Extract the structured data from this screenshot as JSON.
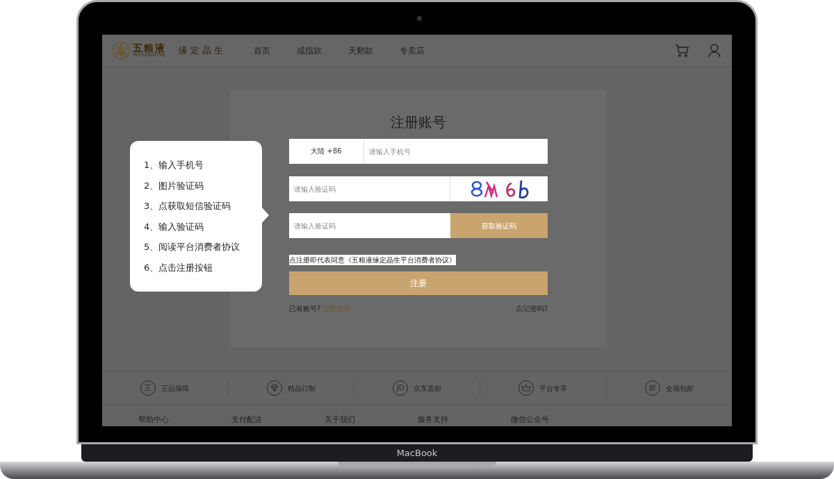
{
  "device": {
    "label": "MacBook"
  },
  "header": {
    "brand": {
      "name": "五粮液",
      "latin": "WULIANGYE",
      "slogan": "缘定晶生"
    },
    "nav": [
      {
        "label": "首页"
      },
      {
        "label": "戒指款"
      },
      {
        "label": "天鹅款"
      },
      {
        "label": "专卖店"
      }
    ]
  },
  "form": {
    "title": "注册账号",
    "phone": {
      "country": "大陆 +86",
      "placeholder": "请输入手机号"
    },
    "captcha": {
      "placeholder": "请输入验证码"
    },
    "sms": {
      "placeholder": "请输入验证码",
      "button": "获取验证码"
    },
    "agreement": "点注册即代表同意《五粮液缘定晶生平台消费者协议》",
    "submit": "注册",
    "login_prompt": "已有账号?",
    "login_link": "立即登录",
    "forgot": "忘记密码?"
  },
  "callout": {
    "steps": [
      "1、输入手机号",
      "2、图片验证码",
      "3、点获取短信验证码",
      "4、输入验证码",
      "5、阅读平台消费者协议",
      "6、点击注册按钮"
    ]
  },
  "features": [
    {
      "kind": "glyph",
      "glyph": "正",
      "label": "正品保障"
    },
    {
      "kind": "diamond",
      "label": "精品订制"
    },
    {
      "kind": "glyph",
      "glyph": "JD",
      "label": "京东直邮"
    },
    {
      "kind": "crown",
      "label": "平台专享"
    },
    {
      "kind": "glyph",
      "glyph": "邮",
      "label": "全场包邮"
    }
  ],
  "footer_links": [
    "帮助中心",
    "支付配送",
    "关于我们",
    "服务支持",
    "微信公众号"
  ]
}
